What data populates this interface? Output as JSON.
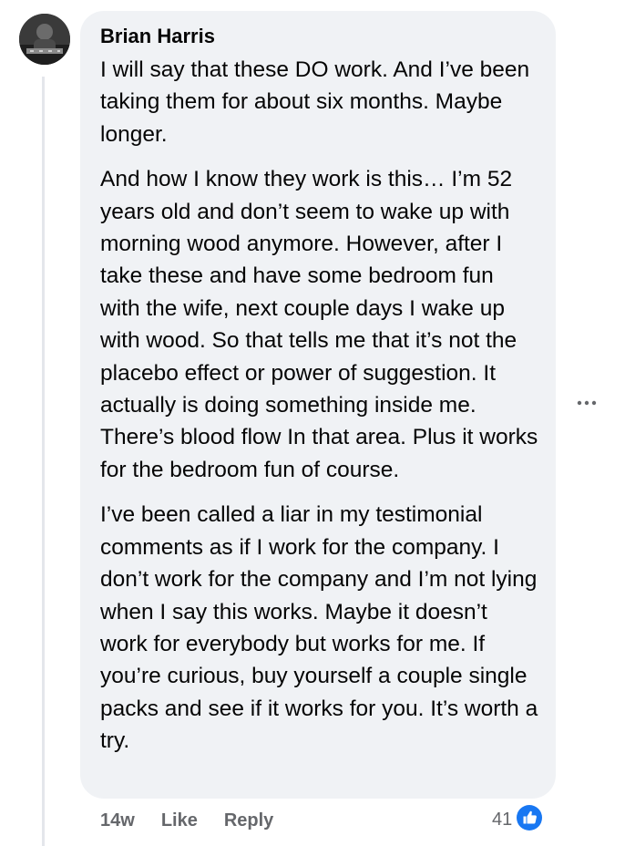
{
  "comment": {
    "author": "Brian Harris",
    "paragraphs": [
      "I will say that these DO work. And I’ve been taking them for about six months. Maybe longer.",
      "And how I know they work is this… I’m 52 years old and don’t seem to wake up with morning wood anymore. However, after I take these and have some bedroom fun with the wife, next couple days I wake up with wood. So that tells me that it’s not the placebo effect or power of suggestion. It actually is doing something inside me. There’s blood flow In that area. Plus it works for the bedroom fun of course.",
      "I’ve been called a liar in my testimonial comments as if I work for the company. I don’t work for the company and I’m not lying when I say this works. Maybe it doesn’t work for everybody but works for me. If you’re curious, buy yourself a couple single packs and see if it works for you. It’s worth a try."
    ],
    "timestamp": "14w",
    "like_label": "Like",
    "reply_label": "Reply",
    "reaction_count": "41",
    "reaction_icon": "thumbs-up-icon",
    "more_icon": "more-options-icon"
  },
  "colors": {
    "bubble_bg": "#f0f2f5",
    "text": "#050505",
    "meta_text": "#65676b",
    "like_blue": "#1877f2",
    "thread_line": "#e4e6eb"
  }
}
